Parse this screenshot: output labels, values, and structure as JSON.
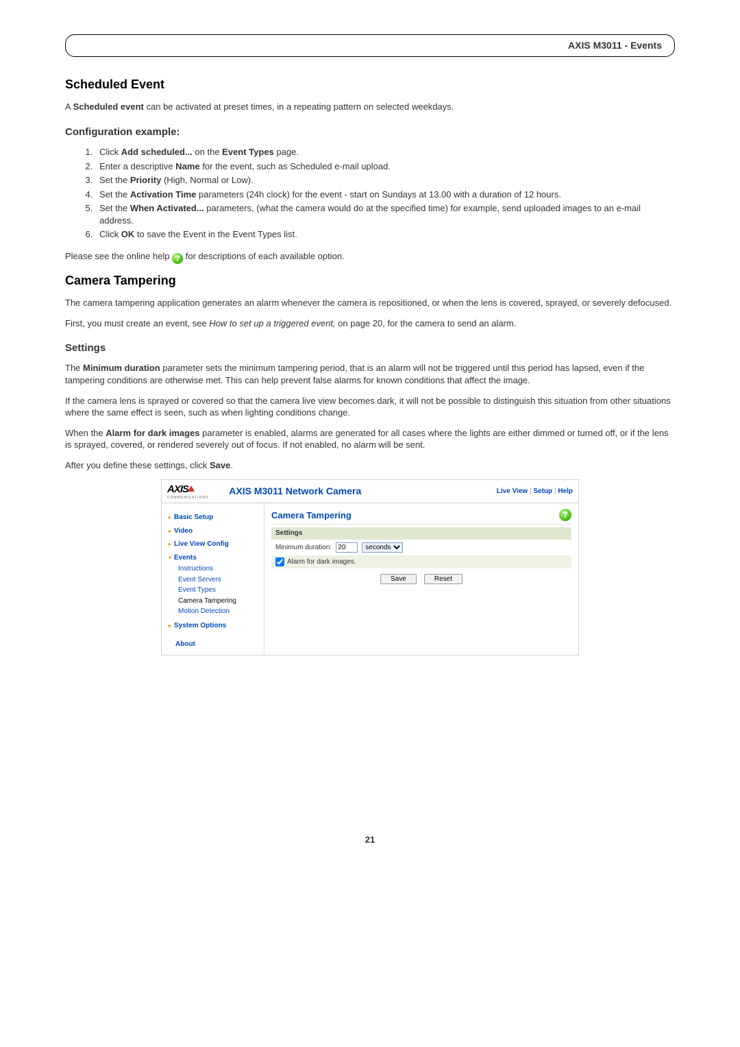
{
  "header": {
    "title": "AXIS M3011 - Events"
  },
  "scheduled": {
    "heading": "Scheduled Event",
    "intro_a": "A ",
    "intro_b": "Scheduled event",
    "intro_c": " can be activated at preset times, in a repeating pattern on selected weekdays."
  },
  "config_example": {
    "heading": "Configuration example:",
    "steps": {
      "s1a": "Click ",
      "s1b": "Add scheduled...",
      "s1c": " on the ",
      "s1d": "Event Types",
      "s1e": " page.",
      "s2a": "Enter a descriptive ",
      "s2b": "Name",
      "s2c": " for the event, such as Scheduled e-mail upload.",
      "s3a": "Set the ",
      "s3b": "Priority",
      "s3c": " (High, Normal or Low).",
      "s4a": "Set the ",
      "s4b": "Activation Time",
      "s4c": " parameters (24h clock) for the event - start on Sundays at 13.00 with a duration of 12 hours.",
      "s5a": "Set the ",
      "s5b": "When Activated...",
      "s5c": " parameters, (what the camera would do at the specified time) for example, send uploaded images to an e-mail address.",
      "s6a": "Click ",
      "s6b": "OK",
      "s6c": " to save the Event in the Event Types list."
    },
    "help_a": "Please see the online help ",
    "help_b": " for descriptions of each available option."
  },
  "tampering": {
    "heading": "Camera Tampering",
    "p1": "The camera tampering application generates an alarm whenever the camera is repositioned, or when the lens is covered, sprayed, or severely defocused.",
    "p2a": "First, you must create an event, see ",
    "p2b": "How to set up a triggered event,",
    "p2c": " on page 20, for the camera to send an alarm."
  },
  "settings": {
    "heading": "Settings",
    "p1a": "The ",
    "p1b": "Minimum duration",
    "p1c": " parameter sets the minimum tampering period, that is an alarm will not be triggered until this period has lapsed, even if the tampering conditions are otherwise met. This can help prevent false alarms for known conditions that affect the image.",
    "p2": "If the camera lens is sprayed or covered so that the camera live view becomes dark, it will not be possible to distinguish this situation from other situations where the same effect is seen, such as when lighting conditions change.",
    "p3a": "When the ",
    "p3b": "Alarm for dark images",
    "p3c": " parameter is enabled, alarms are generated for all cases where the lights are either dimmed or turned off, or if the lens is sprayed, covered, or rendered severely out of focus. If not enabled, no alarm will be sent.",
    "p4a": "After you define these settings, click ",
    "p4b": "Save",
    "p4c": "."
  },
  "ui": {
    "logo": "AXIS",
    "logo_sub": "COMMUNICATIONS",
    "title": "AXIS M3011 Network Camera",
    "links": {
      "live": "Live View",
      "setup": "Setup",
      "help": "Help"
    },
    "nav": {
      "basic": "Basic Setup",
      "video": "Video",
      "live": "Live View Config",
      "events": "Events",
      "events_sub": {
        "instructions": "Instructions",
        "servers": "Event Servers",
        "types": "Event Types",
        "tampering": "Camera Tampering",
        "motion": "Motion Detection"
      },
      "system": "System Options",
      "about": "About"
    },
    "main": {
      "heading": "Camera Tampering",
      "settings_label": "Settings",
      "min_dur_label": "Minimum duration:",
      "min_dur_value": "20",
      "min_dur_unit": "seconds",
      "alarm_dark": "Alarm for dark images.",
      "save": "Save",
      "reset": "Reset"
    }
  },
  "page_number": "21"
}
